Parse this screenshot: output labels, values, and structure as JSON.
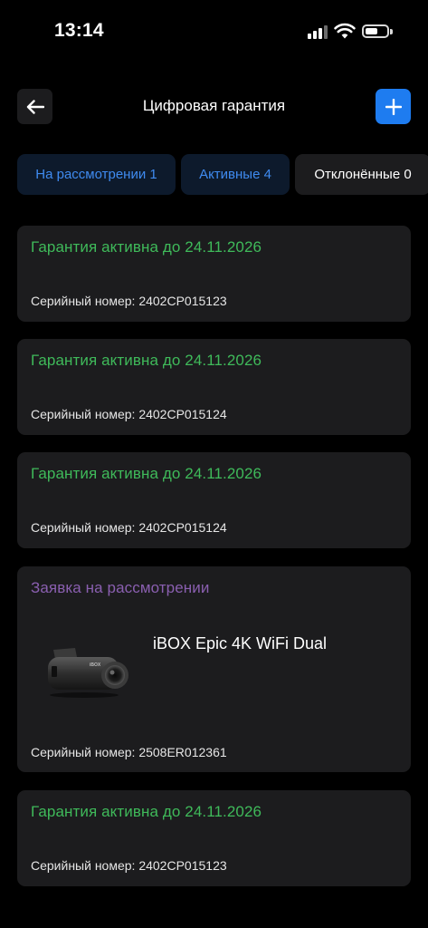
{
  "status_bar": {
    "time": "13:14"
  },
  "header": {
    "title": "Цифровая гарантия"
  },
  "tabs": [
    {
      "label": "На рассмотрении 1"
    },
    {
      "label": "Активные 4"
    },
    {
      "label": "Отклонённые 0"
    }
  ],
  "serial_label": "Серийный номер:",
  "cards": [
    {
      "status": "Гарантия активна до 24.11.2026",
      "serial": "2402CP015123"
    },
    {
      "status": "Гарантия активна до 24.11.2026",
      "serial": "2402CP015124"
    },
    {
      "status": "Гарантия активна до 24.11.2026",
      "serial": "2402CP015124"
    },
    {
      "status": "Заявка на рассмотрении",
      "product": "iBOX Epic 4K WiFi Dual",
      "serial": "2508ER012361"
    },
    {
      "status": "Гарантия активна до 24.11.2026",
      "serial": "2402CP015123"
    }
  ],
  "colors": {
    "active_status": "#3fba5a",
    "pending_status": "#8a5fb0",
    "accent": "#1e7cf0",
    "card_bg": "#1c1c1e"
  },
  "icons": {
    "back": "arrow-left-icon",
    "add": "plus-icon"
  }
}
